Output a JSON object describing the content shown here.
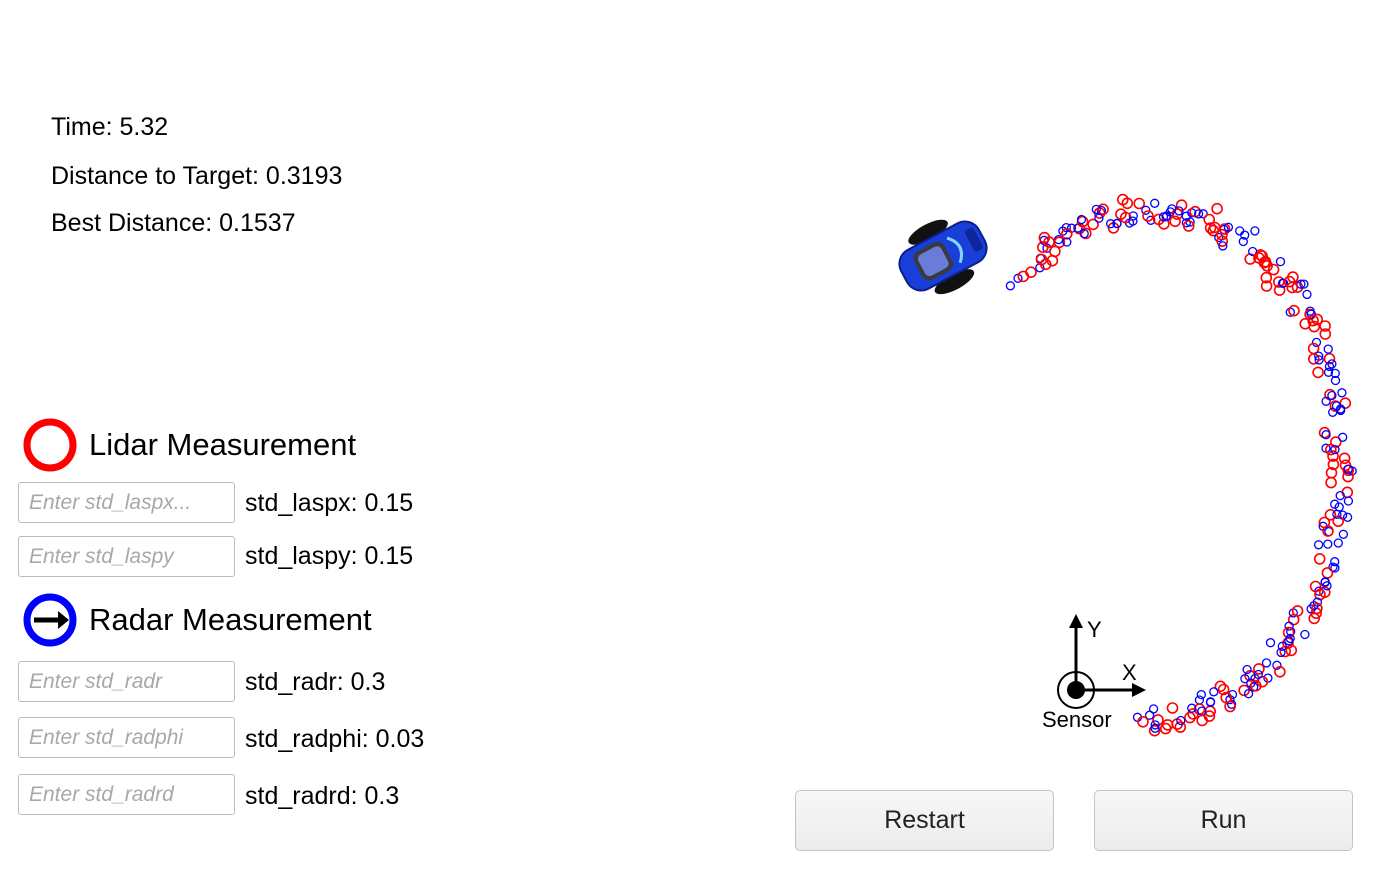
{
  "stats": {
    "time": "Time: 5.32",
    "distance": "Distance to Target: 0.3193",
    "best": "Best Distance: 0.1537"
  },
  "lidar": {
    "title": "Lidar Measurement",
    "color": "#ff0000",
    "fields": [
      {
        "placeholder": "Enter std_laspx...",
        "label": "std_laspx: 0.15"
      },
      {
        "placeholder": "Enter std_laspy",
        "label": "std_laspy: 0.15"
      }
    ]
  },
  "radar": {
    "title": "Radar Measurement",
    "color": "#0000ff",
    "fields": [
      {
        "placeholder": "Enter std_radr",
        "label": "std_radr: 0.3"
      },
      {
        "placeholder": "Enter std_radphi",
        "label": "std_radphi: 0.03"
      },
      {
        "placeholder": "Enter std_radrd",
        "label": "std_radrd: 0.3"
      }
    ]
  },
  "scene": {
    "axis_y": "Y",
    "axis_x": "X",
    "sensor_label": "Sensor",
    "car_color": "#1a3fd8"
  },
  "buttons": {
    "restart": "Restart",
    "run": "Run"
  }
}
